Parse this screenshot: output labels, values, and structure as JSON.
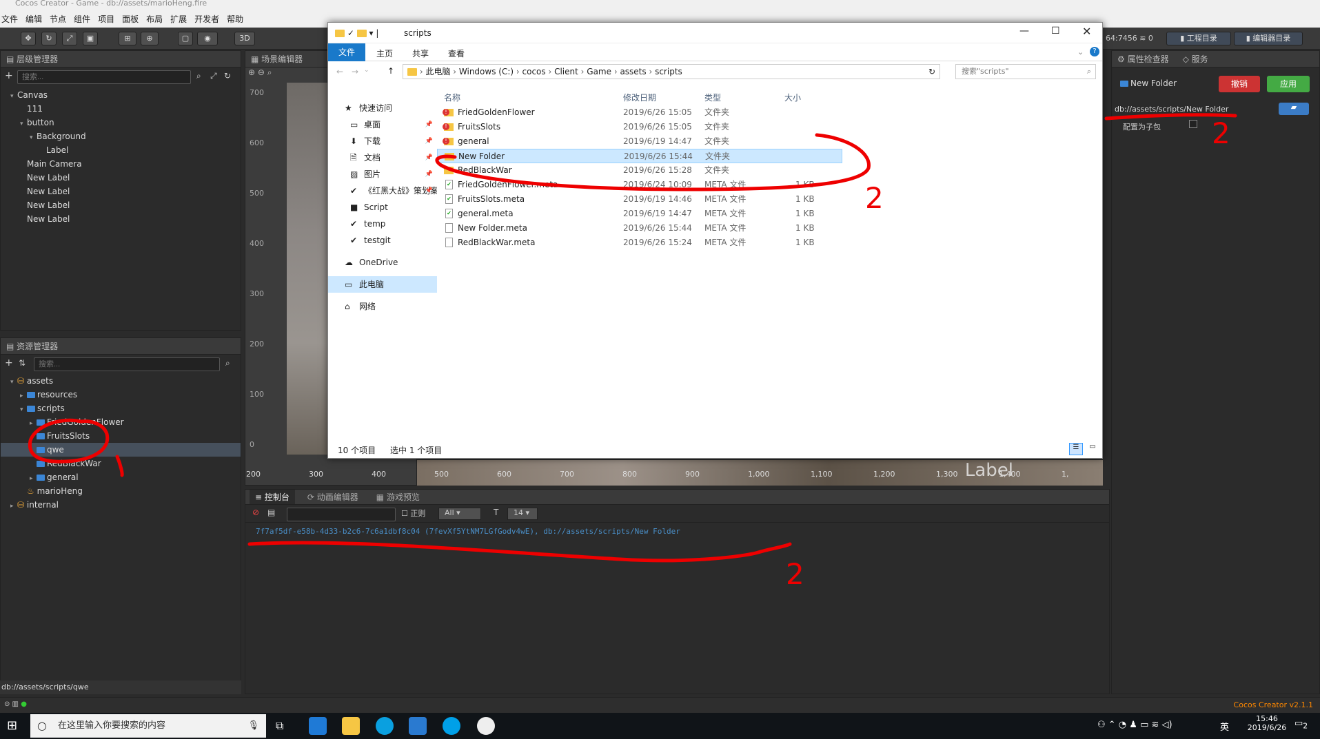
{
  "app": {
    "title": "Cocos Creator - Game - db://assets/marioHeng.fire",
    "menu": [
      "文件",
      "编辑",
      "节点",
      "组件",
      "项目",
      "面板",
      "布局",
      "扩展",
      "开发者",
      "帮助"
    ],
    "toolbar_3d": "3D",
    "ip_status": "64:7456",
    "wifi_count": "0",
    "project_dir_button": "工程目录",
    "editor_dir_button": "编辑器目录",
    "version": "Cocos Creator v2.1.1"
  },
  "hierarchy": {
    "title": "层级管理器",
    "search_placeholder": "搜索...",
    "nodes": [
      "Canvas",
      "111",
      "button",
      "Background",
      "Label",
      "Main Camera",
      "New Label",
      "New Label",
      "New Label",
      "New Label"
    ]
  },
  "assets": {
    "title": "资源管理器",
    "search_placeholder": "搜索...",
    "items": [
      "assets",
      "resources",
      "scripts",
      "FriedGoldenFlower",
      "FruitsSlots",
      "qwe",
      "RedBlackWar",
      "general",
      "marioHeng",
      "internal"
    ],
    "status_path": "db://assets/scripts/qwe"
  },
  "scene": {
    "title": "场景编辑器",
    "y_ticks": [
      "700",
      "600",
      "500",
      "400",
      "300",
      "200",
      "100",
      "0"
    ],
    "x_ticks": [
      "200",
      "300",
      "400",
      "500",
      "600",
      "700",
      "800",
      "900",
      "1,000",
      "1,100",
      "1,200",
      "1,300",
      "1,400",
      "1,"
    ],
    "overlay_text": "Label"
  },
  "console": {
    "tabs": [
      "控制台",
      "动画编辑器",
      "游戏预览"
    ],
    "regex_label": "正则",
    "level_select": "All",
    "font_size": "14",
    "log_line": "7f7af5df-e58b-4d33-b2c6-7c6a1dbf8c04 (7fevXf5YtNM7LGfGodv4wE), db://assets/scripts/New Folder"
  },
  "inspector": {
    "tabs": [
      "属性检查器",
      "服务"
    ],
    "name": "New Folder",
    "revert_button": "撤销",
    "apply_button": "应用",
    "path": "db://assets/scripts/New Folder",
    "subpackage_label": "配置为子包"
  },
  "explorer": {
    "window_title": "scripts",
    "ribbon_tabs": [
      "文件",
      "主页",
      "共享",
      "查看"
    ],
    "breadcrumb": [
      "此电脑",
      "Windows (C:)",
      "cocos",
      "Client",
      "Game",
      "assets",
      "scripts"
    ],
    "search_placeholder": "搜索\"scripts\"",
    "nav": {
      "quick_access": "快速访问",
      "quick_items": [
        "桌面",
        "下载",
        "文档",
        "图片",
        "《红黑大战》策划案",
        "Script",
        "temp",
        "testgit"
      ],
      "onedrive": "OneDrive",
      "this_pc": "此电脑",
      "network": "网络"
    },
    "columns": [
      "名称",
      "修改日期",
      "类型",
      "大小"
    ],
    "files": [
      {
        "name": "FriedGoldenFlower",
        "date": "2019/6/26 15:05",
        "type": "文件夹",
        "size": "",
        "icon": "folder-conflict-icon"
      },
      {
        "name": "FruitsSlots",
        "date": "2019/6/26 15:05",
        "type": "文件夹",
        "size": "",
        "icon": "folder-conflict-icon"
      },
      {
        "name": "general",
        "date": "2019/6/19 14:47",
        "type": "文件夹",
        "size": "",
        "icon": "folder-conflict-icon"
      },
      {
        "name": "New Folder",
        "date": "2019/6/26 15:44",
        "type": "文件夹",
        "size": "",
        "icon": "folder-icon"
      },
      {
        "name": "RedBlackWar",
        "date": "2019/6/26 15:28",
        "type": "文件夹",
        "size": "",
        "icon": "folder-icon"
      },
      {
        "name": "FriedGoldenFlower.meta",
        "date": "2019/6/24 10:09",
        "type": "META 文件",
        "size": "1 KB",
        "icon": "file-synced-icon"
      },
      {
        "name": "FruitsSlots.meta",
        "date": "2019/6/19 14:46",
        "type": "META 文件",
        "size": "1 KB",
        "icon": "file-synced-icon"
      },
      {
        "name": "general.meta",
        "date": "2019/6/19 14:47",
        "type": "META 文件",
        "size": "1 KB",
        "icon": "file-synced-icon"
      },
      {
        "name": "New Folder.meta",
        "date": "2019/6/26 15:44",
        "type": "META 文件",
        "size": "1 KB",
        "icon": "file-icon"
      },
      {
        "name": "RedBlackWar.meta",
        "date": "2019/6/26 15:24",
        "type": "META 文件",
        "size": "1 KB",
        "icon": "file-icon"
      }
    ],
    "status_count": "10 个项目",
    "status_selected": "选中 1 个项目"
  },
  "annotations": {
    "mark_1": "1",
    "mark_2a": "2",
    "mark_2b": "2",
    "mark_2c": "2"
  },
  "taskbar": {
    "search_placeholder": "在这里输入你要搜索的内容",
    "ime": "英",
    "time": "15:46",
    "date": "2019/6/26",
    "notifications": "2"
  }
}
